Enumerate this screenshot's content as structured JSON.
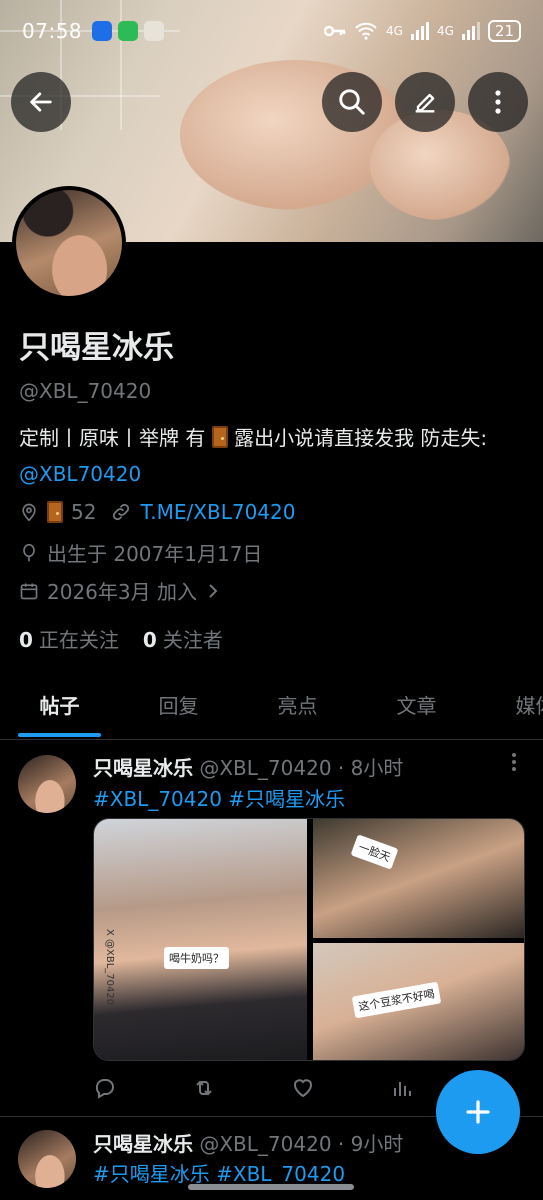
{
  "status_bar": {
    "time": "07:58",
    "network_a": "4G",
    "network_b": "4G",
    "wifi_label": "6",
    "battery": "21"
  },
  "profile": {
    "name": "只喝星冰乐",
    "handle": "@XBL_70420",
    "bio_text": "定制丨原味丨举牌 有",
    "bio_text2": " 露出小说请直接发我 防走失: ",
    "bio_link": "@XBL70420",
    "location": "52",
    "website": "T.ME/XBL70420",
    "birthday": "出生于 2007年1月17日",
    "joined": "2026年3月 加入",
    "following_count": "0",
    "following_label": "正在关注",
    "followers_count": "0",
    "followers_label": "关注者"
  },
  "tabs": [
    "帖子",
    "回复",
    "亮点",
    "文章",
    "媒体"
  ],
  "tweets": [
    {
      "name": "只喝星冰乐",
      "handle": "@XBL_70420",
      "time": "· 8小时",
      "tags": "#XBL_70420 #只喝星冰乐",
      "captions": [
        "喝牛奶吗？",
        "一脸天",
        "这个豆浆不好喝"
      ],
      "watermark": "X @XBL_70420"
    },
    {
      "name": "只喝星冰乐",
      "handle": "@XBL_70420",
      "time": "· 9小时",
      "tags": "#只喝星冰乐 #XBL_70420"
    }
  ],
  "icons": {
    "back": "arrow-left-icon",
    "search": "search-icon",
    "edit": "pencil-icon",
    "more": "more-vertical-icon",
    "location": "location-pin-icon",
    "link": "link-icon",
    "birthday": "balloon-icon",
    "calendar": "calendar-icon",
    "reply": "reply-icon",
    "retweet": "retweet-icon",
    "like": "heart-icon",
    "views": "bar-chart-icon",
    "compose": "plus-icon"
  },
  "colors": {
    "accent": "#1d9bf0",
    "background": "#000000",
    "secondary_text": "#71767b"
  }
}
